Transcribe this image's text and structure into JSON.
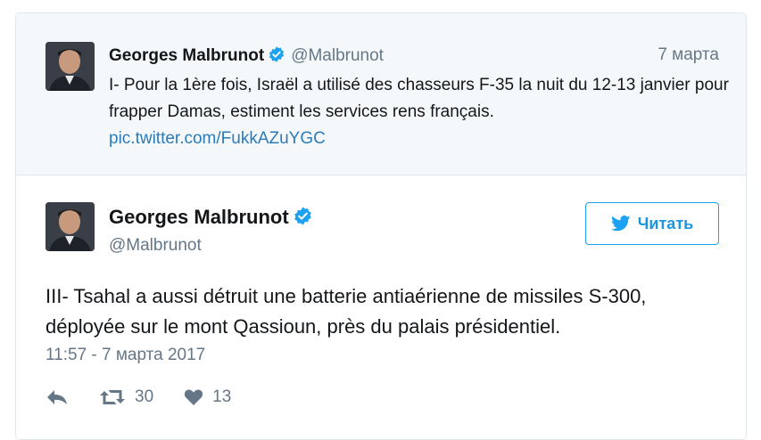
{
  "quoted_tweet": {
    "author_name": "Georges Malbrunot",
    "handle": "@Malbrunot",
    "date": "7 марта",
    "text": "I- Pour la 1ère fois, Israël a utilisé des chasseurs F-35 la nuit du 12-13 janvier pour frapper Damas, estiment les services rens français.",
    "link": "pic.twitter.com/FukkAZuYGC"
  },
  "main_tweet": {
    "author_name": "Georges Malbrunot",
    "handle": "@Malbrunot",
    "follow_label": "Читать",
    "text": "III- Tsahal a aussi détruit une batterie antiaérienne de missiles S-300, déployée sur le mont Qassioun, près du palais présidentiel.",
    "timestamp": "11:57 - 7 марта 2017",
    "retweet_count": "30",
    "like_count": "13"
  },
  "colors": {
    "accent": "#1da1f2",
    "link": "#2b7bb9",
    "muted": "#657786",
    "quoted_bg": "#f5f8fa"
  },
  "icons": [
    "verified-badge-icon",
    "twitter-bird-icon",
    "reply-icon",
    "retweet-icon",
    "heart-icon"
  ]
}
